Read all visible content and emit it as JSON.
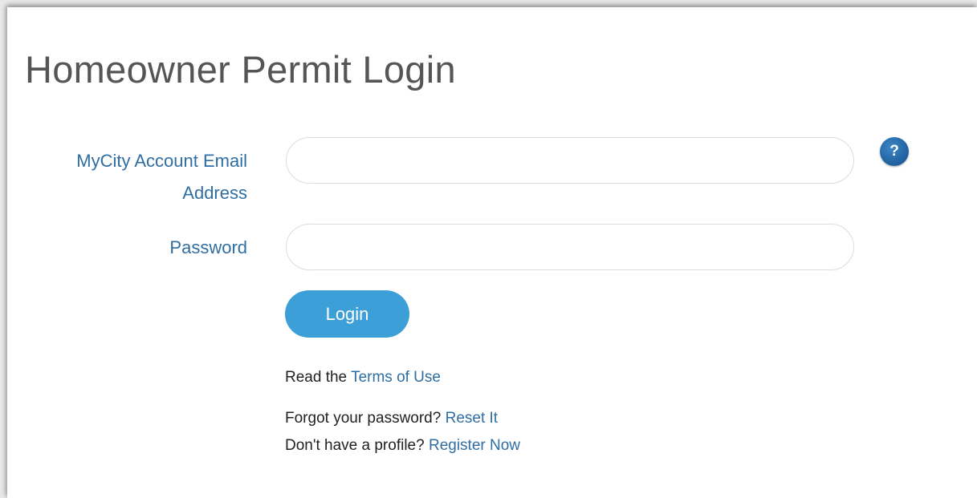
{
  "page": {
    "title": "Homeowner Permit Login"
  },
  "form": {
    "email_label": "MyCity Account Email Address",
    "email_value": "",
    "email_placeholder": "",
    "password_label": "Password",
    "password_value": "",
    "password_placeholder": "",
    "help_icon": "?",
    "login_label": "Login"
  },
  "links": {
    "terms_prefix": "Read the ",
    "terms_link": "Terms of Use",
    "forgot_prefix": "Forgot your password? ",
    "forgot_link": "Reset It",
    "register_prefix": "Don't have a profile? ",
    "register_link": "Register Now"
  },
  "colors": {
    "title": "#555555",
    "label": "#2f6ea3",
    "button": "#3c9fd8",
    "help_icon": "#1f5f9e",
    "link": "#2f6ea3"
  },
  "icons": {
    "help": "question-mark-icon"
  }
}
